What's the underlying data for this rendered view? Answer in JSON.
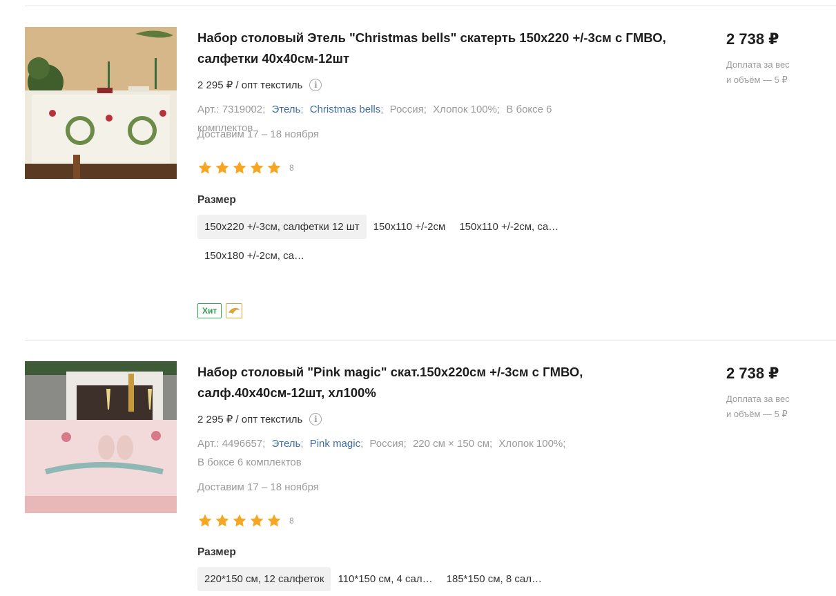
{
  "products": [
    {
      "title": "Набор столовый Этель \"Christmas bells\" скатерть 150х220 +/-3см с ГМВО, салфетки 40х40см-12шт",
      "wholesale_price": "2 295 ₽ / опт текстиль",
      "meta": {
        "article": "Арт.: 7319002",
        "brand": "Этель",
        "collection": "Christmas bells",
        "attrs": [
          "Россия",
          "Хлопок 100%",
          "В боксе 6 комплектов"
        ]
      },
      "delivery": "Доставим 17 – 18 ноября",
      "rating": {
        "stars": 5,
        "count": "8"
      },
      "size_label": "Размер",
      "sizes": [
        "150х220 +/-3см, салфетки 12 шт",
        "150х110 +/-2см",
        "150х110 +/-2см, са…",
        "150х180 +/-2см, са…"
      ],
      "badges": {
        "hit": "Хит",
        "dolphin_icon": "dolphin-icon"
      },
      "price": "2 738 ₽",
      "surcharge_line1": "Доплата за вес",
      "surcharge_line2": "и объём — 5 ₽"
    },
    {
      "title": "Набор столовый \"Pink magic\" скат.150х220см +/-3см с ГМВО, салф.40х40см-12шт, хл100%",
      "wholesale_price": "2 295 ₽ / опт текстиль",
      "meta": {
        "article": "Арт.: 4496657",
        "brand": "Этель",
        "collection": "Pink magic",
        "attrs": [
          "Россия",
          "220 см × 150 см",
          "Хлопок 100%",
          "В боксе 6 комплектов"
        ]
      },
      "delivery": "Доставим 17 – 18 ноября",
      "rating": {
        "stars": 5,
        "count": "8"
      },
      "size_label": "Размер",
      "sizes": [
        "220*150 см, 12 салфеток",
        "110*150 см, 4 сал…",
        "185*150 см, 8 сал…"
      ],
      "price": "2 738 ₽",
      "surcharge_line1": "Доплата за вес",
      "surcharge_line2": "и объём — 5 ₽"
    }
  ],
  "colors": {
    "star": "#f5a623",
    "link": "#3e6fa3",
    "hit": "#34a853",
    "dolphin": "#d7a63f"
  }
}
